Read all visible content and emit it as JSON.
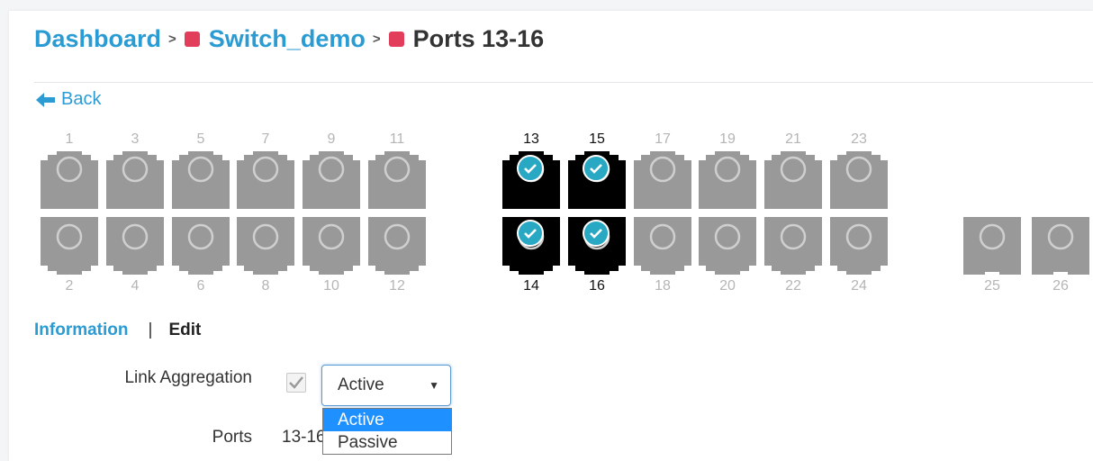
{
  "breadcrumb": {
    "items": [
      "Dashboard",
      "Switch_demo",
      "Ports 13-16"
    ],
    "separator": ">",
    "dot_color": "#e23d5b"
  },
  "back": {
    "label": "Back",
    "icon": "arrow-left-icon"
  },
  "ports": {
    "selected": [
      13,
      14,
      15,
      16
    ],
    "top": [
      "1",
      "3",
      "5",
      "7",
      "9",
      "11",
      "13",
      "15",
      "17",
      "19",
      "21",
      "23"
    ],
    "bottom": [
      "2",
      "4",
      "6",
      "8",
      "10",
      "12",
      "14",
      "16",
      "18",
      "20",
      "22",
      "24"
    ],
    "uplinks": [
      "25",
      "26"
    ],
    "colors": {
      "idle": "#999999",
      "selected": "#000000",
      "check": "#29a8c4"
    }
  },
  "tabs": {
    "information": "Information",
    "separator": "|",
    "edit": "Edit"
  },
  "form": {
    "link_aggregation_label": "Link Aggregation",
    "link_aggregation_checked": true,
    "mode_value": "Active",
    "mode_options": [
      "Active",
      "Passive"
    ],
    "ports_label": "Ports",
    "ports_value": "13-16"
  },
  "colors": {
    "accent": "#2b9bd3",
    "dropdown_highlight": "#1e90ff"
  }
}
